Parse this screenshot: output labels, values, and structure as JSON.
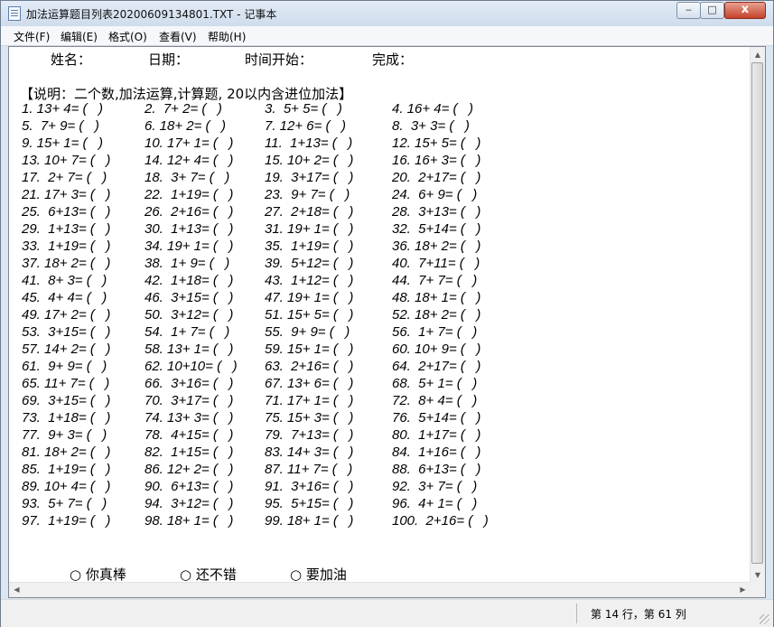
{
  "window": {
    "title": "加法运算题目列表20200609134801.TXT - 记事本",
    "close_glyph": "x"
  },
  "menu": [
    "文件(F)",
    "编辑(E)",
    "格式(O)",
    "查看(V)",
    "帮助(H)"
  ],
  "document": {
    "header_fields": [
      "姓名：",
      "日期：",
      "时间开始：",
      "完成："
    ],
    "description": "【说明：二个数,加法运算,计算题, 20以内含进位加法】",
    "questions": [
      [
        "1. 13+ 4= (   )",
        "2.  7+ 2= (   )",
        "3.  5+ 5= (   )",
        "4. 16+ 4= (   )"
      ],
      [
        "5.  7+ 9= (   )",
        "6. 18+ 2= (   )",
        "7. 12+ 6= (   )",
        "8.  3+ 3= (   )"
      ],
      [
        "9. 15+ 1= (   )",
        "10. 17+ 1= (   )",
        "11.  1+13= (   )",
        "12. 15+ 5= (   )"
      ],
      [
        "13. 10+ 7= (   )",
        "14. 12+ 4= (   )",
        "15. 10+ 2= (   )",
        "16. 16+ 3= (   )"
      ],
      [
        "17.  2+ 7= (   )",
        "18.  3+ 7= (   )",
        "19.  3+17= (   )",
        "20.  2+17= (   )"
      ],
      [
        "21. 17+ 3= (   )",
        "22.  1+19= (   )",
        "23.  9+ 7= (   )",
        "24.  6+ 9= (   )"
      ],
      [
        "25.  6+13= (   )",
        "26.  2+16= (   )",
        "27.  2+18= (   )",
        "28.  3+13= (   )"
      ],
      [
        "29.  1+13= (   )",
        "30.  1+13= (   )",
        "31. 19+ 1= (   )",
        "32.  5+14= (   )"
      ],
      [
        "33.  1+19= (   )",
        "34. 19+ 1= (   )",
        "35.  1+19= (   )",
        "36. 18+ 2= (   )"
      ],
      [
        "37. 18+ 2= (   )",
        "38.  1+ 9= (   )",
        "39.  5+12= (   )",
        "40.  7+11= (   )"
      ],
      [
        "41.  8+ 3= (   )",
        "42.  1+18= (   )",
        "43.  1+12= (   )",
        "44.  7+ 7= (   )"
      ],
      [
        "45.  4+ 4= (   )",
        "46.  3+15= (   )",
        "47. 19+ 1= (   )",
        "48. 18+ 1= (   )"
      ],
      [
        "49. 17+ 2= (   )",
        "50.  3+12= (   )",
        "51. 15+ 5= (   )",
        "52. 18+ 2= (   )"
      ],
      [
        "53.  3+15= (   )",
        "54.  1+ 7= (   )",
        "55.  9+ 9= (   )",
        "56.  1+ 7= (   )"
      ],
      [
        "57. 14+ 2= (   )",
        "58. 13+ 1= (   )",
        "59. 15+ 1= (   )",
        "60. 10+ 9= (   )"
      ],
      [
        "61.  9+ 9= (   )",
        "62. 10+10= (   )",
        "63.  2+16= (   )",
        "64.  2+17= (   )"
      ],
      [
        "65. 11+ 7= (   )",
        "66.  3+16= (   )",
        "67. 13+ 6= (   )",
        "68.  5+ 1= (   )"
      ],
      [
        "69.  3+15= (   )",
        "70.  3+17= (   )",
        "71. 17+ 1= (   )",
        "72.  8+ 4= (   )"
      ],
      [
        "73.  1+18= (   )",
        "74. 13+ 3= (   )",
        "75. 15+ 3= (   )",
        "76.  5+14= (   )"
      ],
      [
        "77.  9+ 3= (   )",
        "78.  4+15= (   )",
        "79.  7+13= (   )",
        "80.  1+17= (   )"
      ],
      [
        "81. 18+ 2= (   )",
        "82.  1+15= (   )",
        "83. 14+ 3= (   )",
        "84.  1+16= (   )"
      ],
      [
        "85.  1+19= (   )",
        "86. 12+ 2= (   )",
        "87. 11+ 7= (   )",
        "88.  6+13= (   )"
      ],
      [
        "89. 10+ 4= (   )",
        "90.  6+13= (   )",
        "91.  3+16= (   )",
        "92.  3+ 7= (   )"
      ],
      [
        "93.  5+ 7= (   )",
        "94.  3+12= (   )",
        "95.  5+15= (   )",
        "96.  4+ 1= (   )"
      ],
      [
        "97.  1+19= (   )",
        "98. 18+ 1= (   )",
        "99. 18+ 1= (   )",
        "100.  2+16= (   )"
      ]
    ],
    "evaluation": [
      "○ 你真棒",
      "○ 还不错",
      "○ 要加油"
    ]
  },
  "status": {
    "position": "第 14 行，第 61 列"
  }
}
